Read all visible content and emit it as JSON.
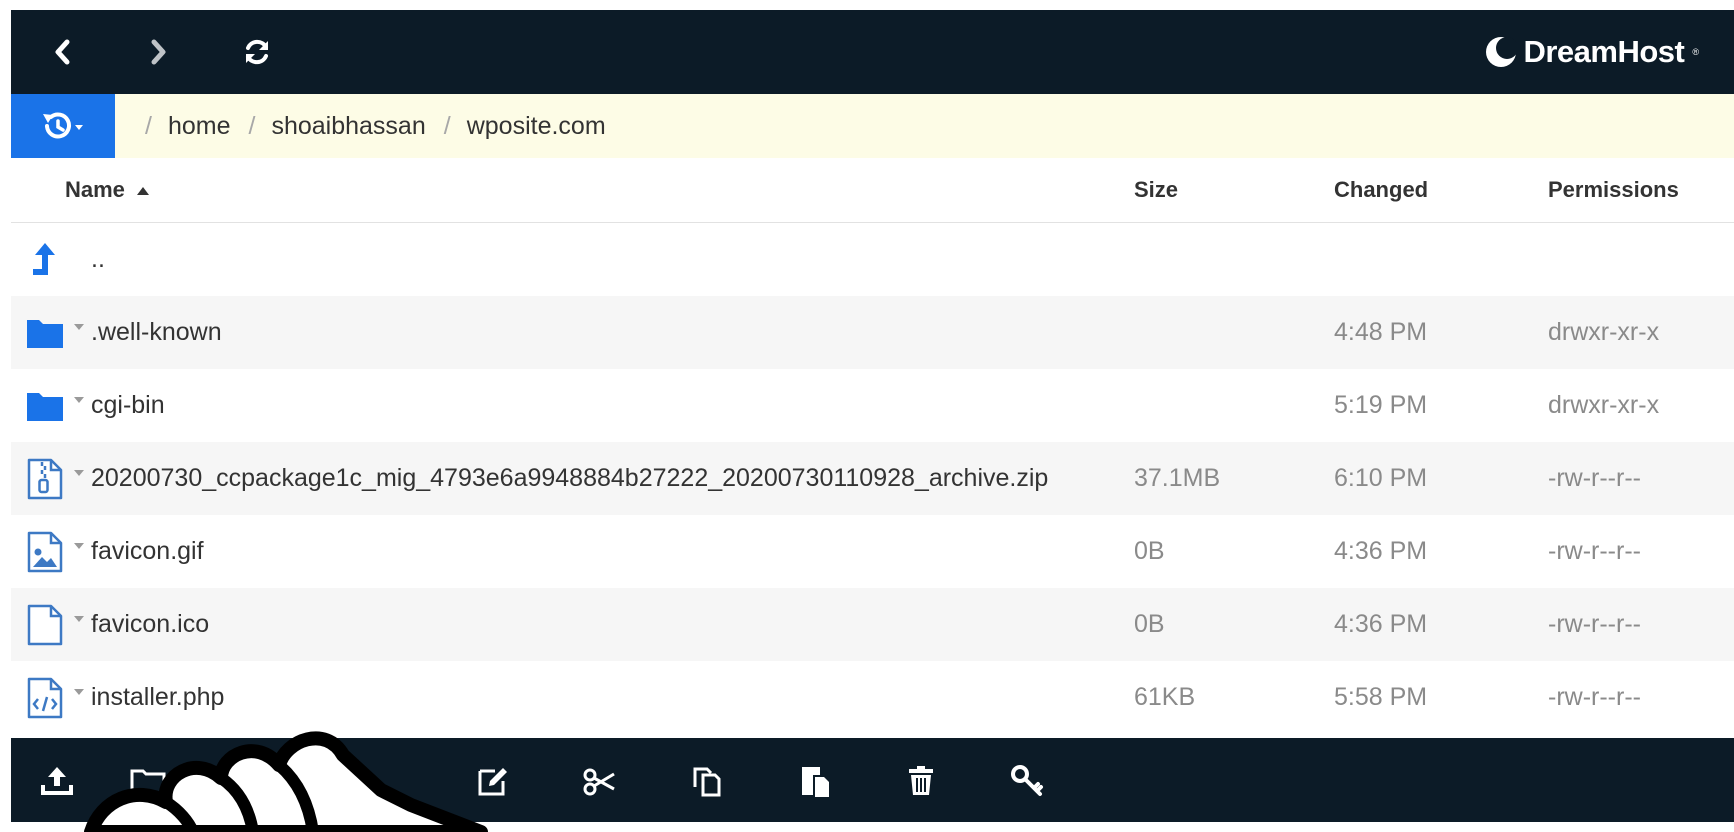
{
  "header": {
    "logo_text": "DreamHost",
    "logo_mark": "®",
    "nav": {
      "back_icon": "chevron-left-icon",
      "forward_icon": "chevron-right-icon",
      "refresh_icon": "refresh-icon"
    }
  },
  "path": {
    "history_icon": "history-icon",
    "segments": [
      "home",
      "shoaibhassan",
      "wposite.com"
    ]
  },
  "table": {
    "columns": {
      "name": "Name",
      "size": "Size",
      "changed": "Changed",
      "permissions": "Permissions"
    },
    "sort": {
      "column": "name",
      "direction": "ascending"
    },
    "rows": [
      {
        "name": "..",
        "icon": "parent-directory-icon",
        "size": "",
        "changed": "",
        "permissions": ""
      },
      {
        "name": ".well-known",
        "icon": "folder-icon",
        "size": "",
        "changed": "4:48 PM",
        "permissions": "drwxr-xr-x"
      },
      {
        "name": "cgi-bin",
        "icon": "folder-icon",
        "size": "",
        "changed": "5:19 PM",
        "permissions": "drwxr-xr-x"
      },
      {
        "name": "20200730_ccpackage1c_mig_4793e6a9948884b27222_20200730110928_archive.zip",
        "icon": "zip-file-icon",
        "size": "37.1MB",
        "changed": "6:10 PM",
        "permissions": "-rw-r--r--"
      },
      {
        "name": "favicon.gif",
        "icon": "image-file-icon",
        "size": "0B",
        "changed": "4:36 PM",
        "permissions": "-rw-r--r--"
      },
      {
        "name": "favicon.ico",
        "icon": "file-icon",
        "size": "0B",
        "changed": "4:36 PM",
        "permissions": "-rw-r--r--"
      },
      {
        "name": "installer.php",
        "icon": "code-file-icon",
        "size": "61KB",
        "changed": "5:58 PM",
        "permissions": "-rw-r--r--"
      }
    ]
  },
  "toolbar": {
    "tools": [
      "upload-icon",
      "new-folder-icon",
      "new-file-icon",
      "rename-icon",
      "cut-icon",
      "copy-icon",
      "paste-icon",
      "delete-icon",
      "permissions-key-icon"
    ]
  },
  "colors": {
    "bar": "#0c1b27",
    "accent": "#1a73e8",
    "pathbar": "#fdfce6",
    "icon_outline": "#3d79c4"
  }
}
